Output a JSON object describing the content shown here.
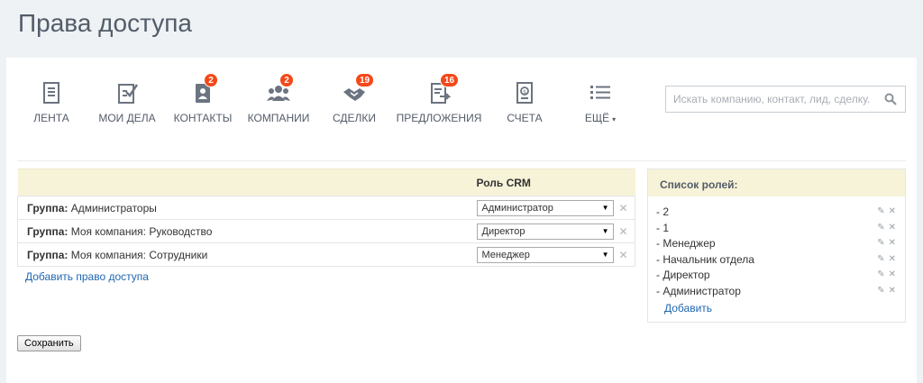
{
  "page": {
    "title": "Права доступа"
  },
  "toolbar": {
    "items": [
      {
        "label": "ЛЕНТА",
        "icon": "feed-icon",
        "badge": ""
      },
      {
        "label": "МОИ ДЕЛА",
        "icon": "tasks-icon",
        "badge": ""
      },
      {
        "label": "КОНТАКТЫ",
        "icon": "contacts-icon",
        "badge": "2"
      },
      {
        "label": "КОМПАНИИ",
        "icon": "companies-icon",
        "badge": "2"
      },
      {
        "label": "СДЕЛКИ",
        "icon": "deals-icon",
        "badge": "19"
      },
      {
        "label": "ПРЕДЛОЖЕНИЯ",
        "icon": "quotes-icon",
        "badge": "16"
      },
      {
        "label": "СЧЕТА",
        "icon": "invoices-icon",
        "badge": ""
      },
      {
        "label": "ЕЩЁ",
        "icon": "list-icon",
        "badge": ""
      }
    ],
    "search_placeholder": "Искать компанию, контакт, лид, сделку.",
    "more_caret": "▾"
  },
  "permissions": {
    "column_header": "Роль CRM",
    "group_key": "Группа:",
    "rows": [
      {
        "group": "Администраторы",
        "role": "Администратор"
      },
      {
        "group": "Моя компания: Руководство",
        "role": "Директор"
      },
      {
        "group": "Моя компания: Сотрудники",
        "role": "Менеджер"
      }
    ],
    "add_link": "Добавить право доступа"
  },
  "roles": {
    "title": "Список ролей:",
    "items": [
      "- 2",
      "- 1",
      "- Менеджер",
      "- Начальник отдела",
      "- Директор",
      "- Администратор"
    ],
    "add_link": "Добавить"
  },
  "actions": {
    "save_label": "Сохранить"
  },
  "colors": {
    "accent_link": "#2067b0",
    "badge": "#f54819",
    "header_bg": "#f7f3d8",
    "page_bg": "#eef2f4"
  }
}
